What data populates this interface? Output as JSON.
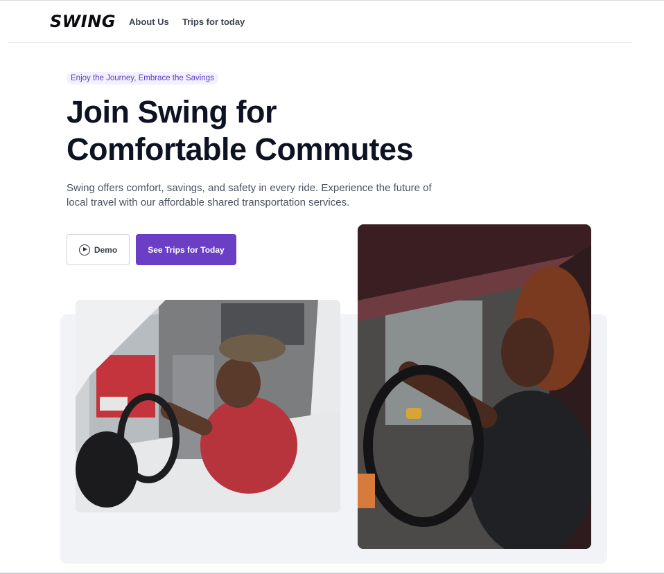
{
  "header": {
    "logo": "SWING",
    "nav": [
      {
        "label": "About Us"
      },
      {
        "label": "Trips for today"
      }
    ]
  },
  "hero": {
    "badge": "Enjoy the Journey, Embrace the Savings",
    "title_line1": "Join Swing for",
    "title_line2": "Comfortable Commutes",
    "subtitle_line1": "Swing offers comfort, savings, and safety in every ride. Experience the future of",
    "subtitle_line2": "local travel with our affordable shared transportation services.",
    "demo_label": "Demo",
    "cta_label": "See Trips for Today"
  },
  "images": [
    {
      "name": "driver-van-photo",
      "subject": "man in red shirt and cap driving a white van"
    },
    {
      "name": "driver-car-photo",
      "subject": "woman with braids gripping steering wheel of dark car"
    }
  ],
  "colors": {
    "accent": "#6a3fc6",
    "badge_bg": "#f3f0ff",
    "badge_text": "#5b3cc4",
    "panel_bg": "#f2f3f6",
    "heading": "#0d1322"
  }
}
